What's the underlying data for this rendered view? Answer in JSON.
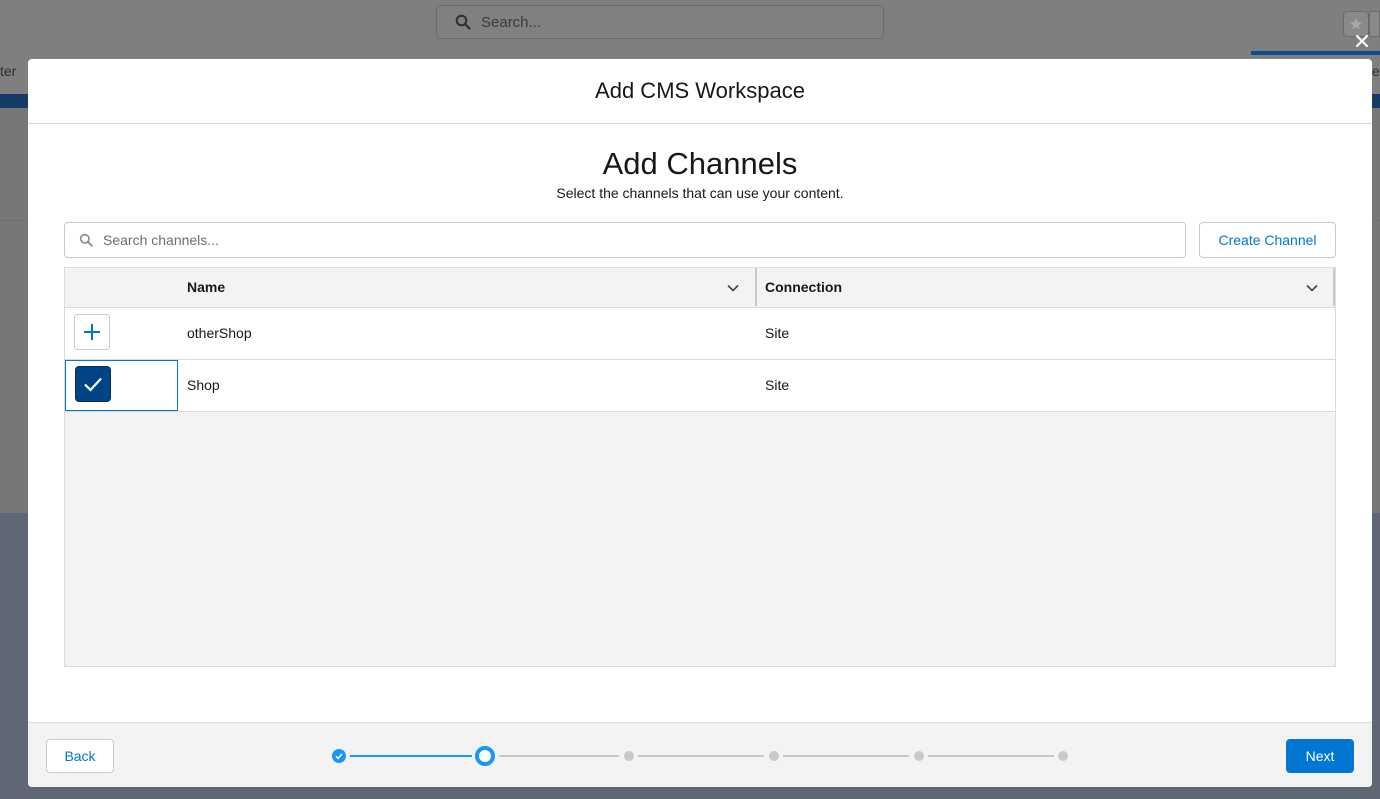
{
  "background": {
    "search_placeholder": "Search...",
    "left_text": "ter",
    "right_text": "es"
  },
  "modal": {
    "title": "Add CMS Workspace",
    "step_title": "Add Channels",
    "step_subtitle": "Select the channels that can use your content.",
    "search_placeholder": "Search channels...",
    "create_channel_label": "Create Channel",
    "columns": {
      "name": "Name",
      "connection": "Connection"
    },
    "rows": [
      {
        "name": "otherShop",
        "connection": "Site",
        "selected": false
      },
      {
        "name": "Shop",
        "connection": "Site",
        "selected": true
      }
    ],
    "footer": {
      "back_label": "Back",
      "next_label": "Next",
      "progress": {
        "current_step": 2,
        "total_steps": 6
      }
    }
  },
  "colors": {
    "brand": "#0176d3",
    "progress_active": "#1b96ff",
    "selected_button": "#014486"
  }
}
